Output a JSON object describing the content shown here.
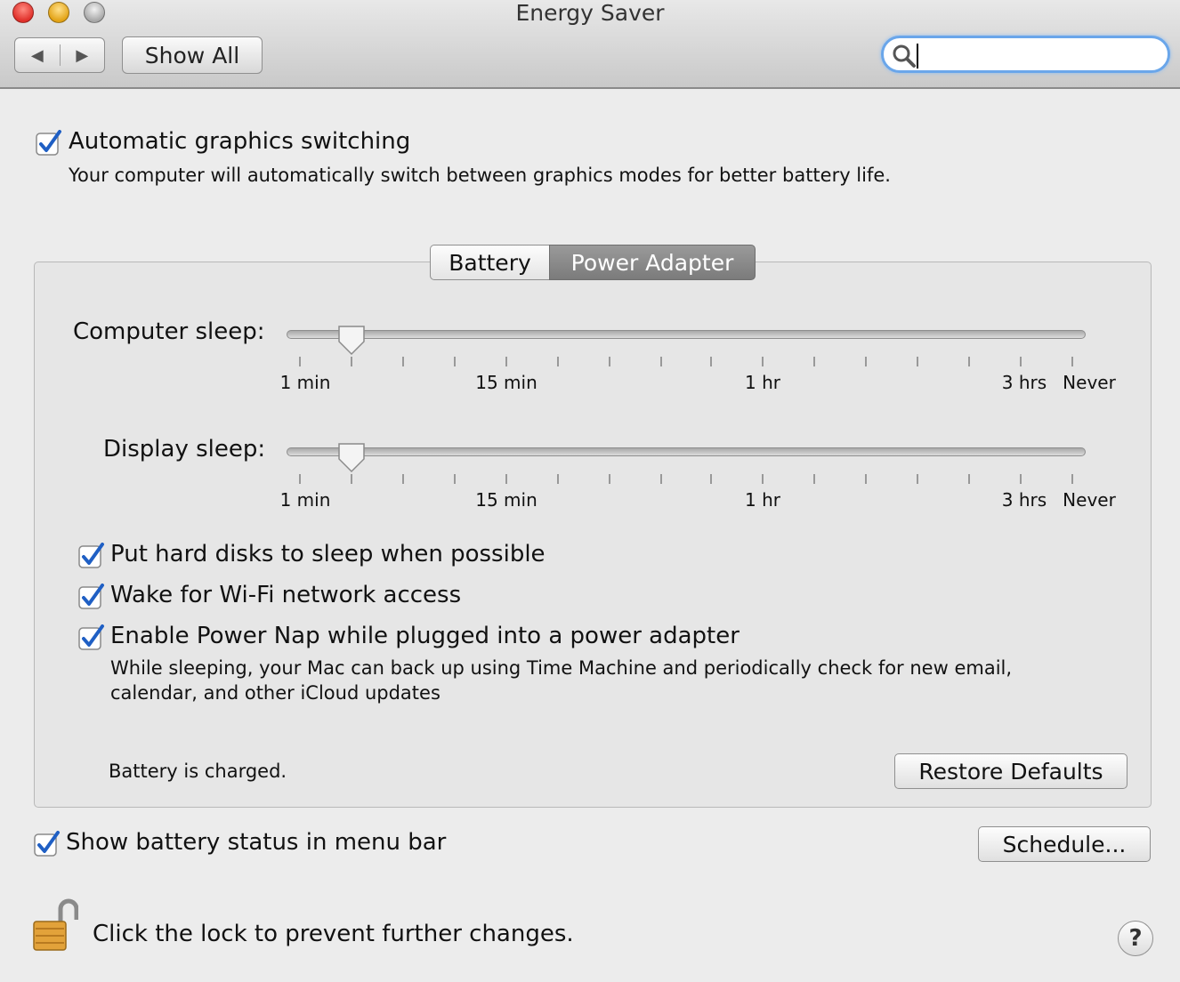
{
  "window": {
    "title": "Energy Saver"
  },
  "toolbar": {
    "back_glyph": "◀",
    "forward_glyph": "▶",
    "show_all_label": "Show All",
    "search_value": "",
    "search_icon": "magnifier-icon"
  },
  "graphics": {
    "checked": true,
    "label": "Automatic graphics switching",
    "description": "Your computer will automatically switch between graphics modes for better battery life."
  },
  "tabs": [
    {
      "label": "Battery",
      "selected": false
    },
    {
      "label": "Power Adapter",
      "selected": true
    }
  ],
  "sliders": {
    "tick_labels": [
      "1 min",
      "15 min",
      "1 hr",
      "3 hrs",
      "Never"
    ],
    "computer_sleep": {
      "label": "Computer sleep:",
      "value": "10 min"
    },
    "display_sleep": {
      "label": "Display sleep:",
      "value": "10 min"
    }
  },
  "options": [
    {
      "label": "Put hard disks to sleep when possible",
      "checked": true
    },
    {
      "label": "Wake for Wi-Fi network access",
      "checked": true
    },
    {
      "label": "Enable Power Nap while plugged into a power adapter",
      "checked": true
    }
  ],
  "power_nap_description_line1": "While sleeping, your Mac can back up using Time Machine and periodically check for new email,",
  "power_nap_description_line2": "calendar, and other iCloud updates",
  "battery_status": "Battery is charged.",
  "restore_defaults_label": "Restore Defaults",
  "show_battery_status": {
    "label": "Show battery status in menu bar",
    "checked": true
  },
  "schedule_label": "Schedule...",
  "lock": {
    "text": "Click the lock to prevent further changes.",
    "state": "unlocked",
    "icon": "padlock-open-icon"
  },
  "help_label": "?",
  "colors": {
    "accent": "#2a6fd6",
    "search_focus": "#6aa6ea",
    "selected_tab": "#7b7b7b"
  }
}
